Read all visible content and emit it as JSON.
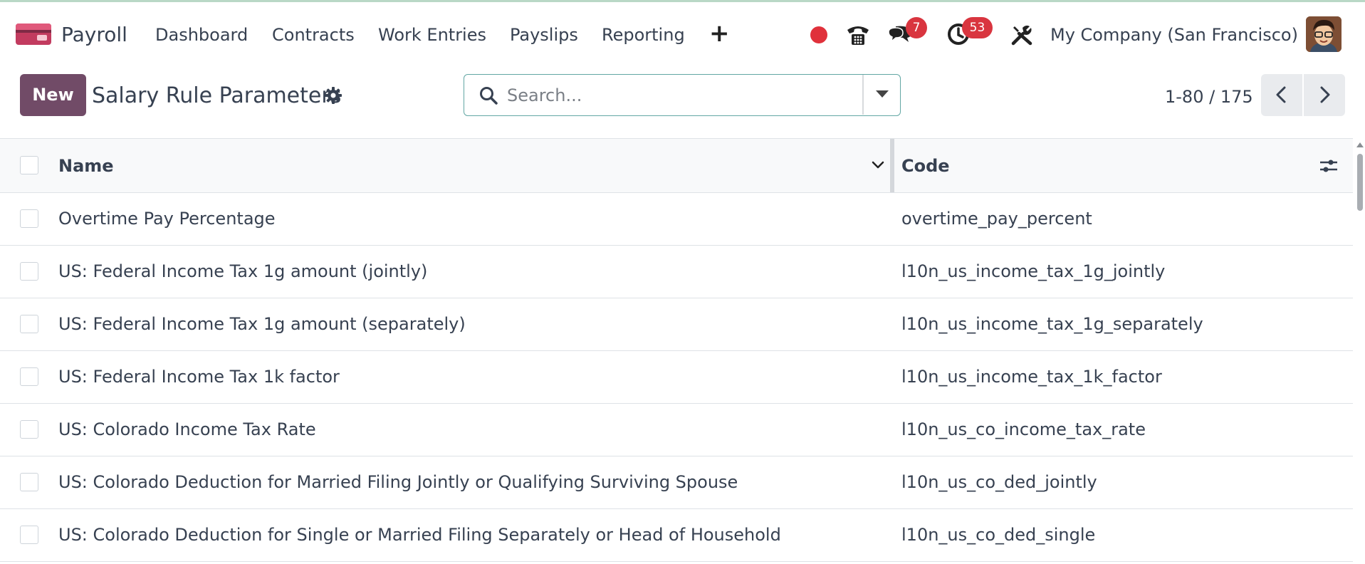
{
  "app": {
    "name": "Payroll"
  },
  "navbar": {
    "menu": [
      "Dashboard",
      "Contracts",
      "Work Entries",
      "Payslips",
      "Reporting"
    ],
    "add_icon": "plus-icon",
    "messages_badge": "7",
    "activities_badge": "53",
    "company": "My Company (San Francisco)",
    "record_color": "#e0313b",
    "badge_color": "#d9353f"
  },
  "control": {
    "new_label": "New",
    "title": "Salary Rule Parameters",
    "search_placeholder": "Search...",
    "pager": "1-80 / 175",
    "accent": "#714b67"
  },
  "list": {
    "columns": {
      "name": "Name",
      "code": "Code"
    },
    "rows": [
      {
        "name": "Overtime Pay Percentage",
        "code": "overtime_pay_percent"
      },
      {
        "name": "US: Federal Income Tax 1g amount (jointly)",
        "code": "l10n_us_income_tax_1g_jointly"
      },
      {
        "name": "US: Federal Income Tax 1g amount (separately)",
        "code": "l10n_us_income_tax_1g_separately"
      },
      {
        "name": "US: Federal Income Tax 1k factor",
        "code": "l10n_us_income_tax_1k_factor"
      },
      {
        "name": "US: Colorado Income Tax Rate",
        "code": "l10n_us_co_income_tax_rate"
      },
      {
        "name": "US: Colorado Deduction for Married Filing Jointly or Qualifying Surviving Spouse",
        "code": "l10n_us_co_ded_jointly"
      },
      {
        "name": "US: Colorado Deduction for Single or Married Filing Separately or Head of Household",
        "code": "l10n_us_co_ded_single"
      }
    ]
  }
}
